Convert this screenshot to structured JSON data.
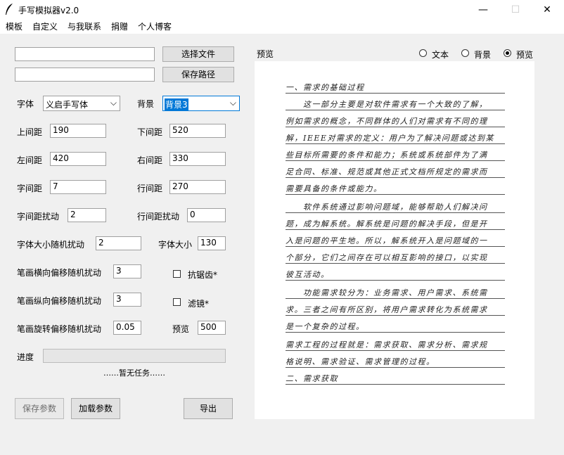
{
  "window": {
    "title": "手写模拟器v2.0",
    "controls": {
      "minimize": "—",
      "maximize": "☐",
      "close": "✕"
    }
  },
  "menu": [
    "模板",
    "自定义",
    "与我联系",
    "捐赠",
    "个人博客"
  ],
  "files": {
    "file_input": "",
    "select_file_label": "选择文件",
    "save_path_input": "",
    "save_path_label": "保存路径"
  },
  "font": {
    "label": "字体",
    "value": "义启手写体"
  },
  "background": {
    "label": "背景",
    "value": "背景3"
  },
  "fields": {
    "top_margin": {
      "label": "上间距",
      "value": "190"
    },
    "bottom_margin": {
      "label": "下间距",
      "value": "520"
    },
    "left_margin": {
      "label": "左间距",
      "value": "420"
    },
    "right_margin": {
      "label": "右间距",
      "value": "330"
    },
    "char_spacing": {
      "label": "字间距",
      "value": "7"
    },
    "line_spacing": {
      "label": "行间距",
      "value": "270"
    },
    "char_spacing_jitter": {
      "label": "字间距扰动",
      "value": "2"
    },
    "line_spacing_jitter": {
      "label": "行间距扰动",
      "value": "0"
    },
    "font_size_jitter": {
      "label": "字体大小随机扰动",
      "value": "2"
    },
    "font_size": {
      "label": "字体大小",
      "value": "130"
    },
    "stroke_h_jitter": {
      "label": "笔画横向偏移随机扰动",
      "value": "3"
    },
    "stroke_v_jitter": {
      "label": "笔画纵向偏移随机扰动",
      "value": "3"
    },
    "stroke_rot_jitter": {
      "label": "笔画旋转偏移随机扰动",
      "value": "0.05"
    },
    "preview_size": {
      "label": "预览",
      "value": "500"
    }
  },
  "checkboxes": {
    "antialias": {
      "label": "抗锯齿*",
      "checked": false
    },
    "filter": {
      "label": "滤镜*",
      "checked": false
    }
  },
  "progress": {
    "label": "进度",
    "value": 0,
    "status": "……暂无任务……"
  },
  "buttons": {
    "save_params": "保存参数",
    "load_params": "加载参数",
    "export": "导出"
  },
  "preview": {
    "title": "预览",
    "radios": [
      {
        "label": "文本",
        "selected": false
      },
      {
        "label": "背景",
        "selected": false
      },
      {
        "label": "预览",
        "selected": true
      }
    ],
    "lines": [
      "一、需求的基础过程",
      "　　这一部分主要是对软件需求有一个大致的了解，",
      "例如需求的概念，不同群体的人们对需求有不同的理",
      "解，IEEE对需求的定义：用户为了解决问题或达到某",
      "些目标所需要的条件和能力；系统或系统部件为了满",
      "足合同、标准、规范或其他正式文档所规定的需求而",
      "需要具备的条件或能力。",
      "　　软件系统通过影响问题域，能够帮助人们解决问",
      "题，成为解系统。解系统是问题的解决手段，但是开",
      "入是问题的平生地。所以，解系统开入是问题域的一",
      "个部分，它们之间存在可以相互影响的接口，以实现",
      "彼互活动。",
      "　　功能需求较分为：业务需求、用户需求、系统需",
      "求。三者之间有所区别，将用户需求转化为系统需求",
      "是一个复杂的过程。",
      "需求工程的过程就是：需求获取、需求分析、需求规",
      "格说明、需求验证、需求管理的过程。",
      "二、需求获取"
    ]
  }
}
